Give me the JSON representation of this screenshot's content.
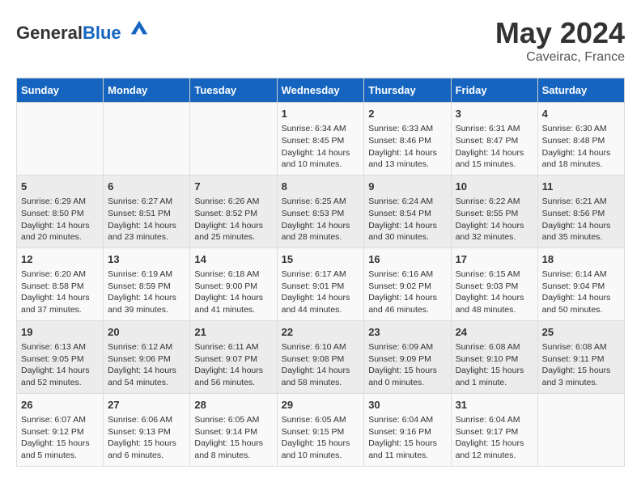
{
  "header": {
    "logo_general": "General",
    "logo_blue": "Blue",
    "month_title": "May 2024",
    "location": "Caveirac, France"
  },
  "weekdays": [
    "Sunday",
    "Monday",
    "Tuesday",
    "Wednesday",
    "Thursday",
    "Friday",
    "Saturday"
  ],
  "weeks": [
    [
      {
        "day": "",
        "text": ""
      },
      {
        "day": "",
        "text": ""
      },
      {
        "day": "",
        "text": ""
      },
      {
        "day": "1",
        "text": "Sunrise: 6:34 AM\nSunset: 8:45 PM\nDaylight: 14 hours\nand 10 minutes."
      },
      {
        "day": "2",
        "text": "Sunrise: 6:33 AM\nSunset: 8:46 PM\nDaylight: 14 hours\nand 13 minutes."
      },
      {
        "day": "3",
        "text": "Sunrise: 6:31 AM\nSunset: 8:47 PM\nDaylight: 14 hours\nand 15 minutes."
      },
      {
        "day": "4",
        "text": "Sunrise: 6:30 AM\nSunset: 8:48 PM\nDaylight: 14 hours\nand 18 minutes."
      }
    ],
    [
      {
        "day": "5",
        "text": "Sunrise: 6:29 AM\nSunset: 8:50 PM\nDaylight: 14 hours\nand 20 minutes."
      },
      {
        "day": "6",
        "text": "Sunrise: 6:27 AM\nSunset: 8:51 PM\nDaylight: 14 hours\nand 23 minutes."
      },
      {
        "day": "7",
        "text": "Sunrise: 6:26 AM\nSunset: 8:52 PM\nDaylight: 14 hours\nand 25 minutes."
      },
      {
        "day": "8",
        "text": "Sunrise: 6:25 AM\nSunset: 8:53 PM\nDaylight: 14 hours\nand 28 minutes."
      },
      {
        "day": "9",
        "text": "Sunrise: 6:24 AM\nSunset: 8:54 PM\nDaylight: 14 hours\nand 30 minutes."
      },
      {
        "day": "10",
        "text": "Sunrise: 6:22 AM\nSunset: 8:55 PM\nDaylight: 14 hours\nand 32 minutes."
      },
      {
        "day": "11",
        "text": "Sunrise: 6:21 AM\nSunset: 8:56 PM\nDaylight: 14 hours\nand 35 minutes."
      }
    ],
    [
      {
        "day": "12",
        "text": "Sunrise: 6:20 AM\nSunset: 8:58 PM\nDaylight: 14 hours\nand 37 minutes."
      },
      {
        "day": "13",
        "text": "Sunrise: 6:19 AM\nSunset: 8:59 PM\nDaylight: 14 hours\nand 39 minutes."
      },
      {
        "day": "14",
        "text": "Sunrise: 6:18 AM\nSunset: 9:00 PM\nDaylight: 14 hours\nand 41 minutes."
      },
      {
        "day": "15",
        "text": "Sunrise: 6:17 AM\nSunset: 9:01 PM\nDaylight: 14 hours\nand 44 minutes."
      },
      {
        "day": "16",
        "text": "Sunrise: 6:16 AM\nSunset: 9:02 PM\nDaylight: 14 hours\nand 46 minutes."
      },
      {
        "day": "17",
        "text": "Sunrise: 6:15 AM\nSunset: 9:03 PM\nDaylight: 14 hours\nand 48 minutes."
      },
      {
        "day": "18",
        "text": "Sunrise: 6:14 AM\nSunset: 9:04 PM\nDaylight: 14 hours\nand 50 minutes."
      }
    ],
    [
      {
        "day": "19",
        "text": "Sunrise: 6:13 AM\nSunset: 9:05 PM\nDaylight: 14 hours\nand 52 minutes."
      },
      {
        "day": "20",
        "text": "Sunrise: 6:12 AM\nSunset: 9:06 PM\nDaylight: 14 hours\nand 54 minutes."
      },
      {
        "day": "21",
        "text": "Sunrise: 6:11 AM\nSunset: 9:07 PM\nDaylight: 14 hours\nand 56 minutes."
      },
      {
        "day": "22",
        "text": "Sunrise: 6:10 AM\nSunset: 9:08 PM\nDaylight: 14 hours\nand 58 minutes."
      },
      {
        "day": "23",
        "text": "Sunrise: 6:09 AM\nSunset: 9:09 PM\nDaylight: 15 hours\nand 0 minutes."
      },
      {
        "day": "24",
        "text": "Sunrise: 6:08 AM\nSunset: 9:10 PM\nDaylight: 15 hours\nand 1 minute."
      },
      {
        "day": "25",
        "text": "Sunrise: 6:08 AM\nSunset: 9:11 PM\nDaylight: 15 hours\nand 3 minutes."
      }
    ],
    [
      {
        "day": "26",
        "text": "Sunrise: 6:07 AM\nSunset: 9:12 PM\nDaylight: 15 hours\nand 5 minutes."
      },
      {
        "day": "27",
        "text": "Sunrise: 6:06 AM\nSunset: 9:13 PM\nDaylight: 15 hours\nand 6 minutes."
      },
      {
        "day": "28",
        "text": "Sunrise: 6:05 AM\nSunset: 9:14 PM\nDaylight: 15 hours\nand 8 minutes."
      },
      {
        "day": "29",
        "text": "Sunrise: 6:05 AM\nSunset: 9:15 PM\nDaylight: 15 hours\nand 10 minutes."
      },
      {
        "day": "30",
        "text": "Sunrise: 6:04 AM\nSunset: 9:16 PM\nDaylight: 15 hours\nand 11 minutes."
      },
      {
        "day": "31",
        "text": "Sunrise: 6:04 AM\nSunset: 9:17 PM\nDaylight: 15 hours\nand 12 minutes."
      },
      {
        "day": "",
        "text": ""
      }
    ]
  ]
}
